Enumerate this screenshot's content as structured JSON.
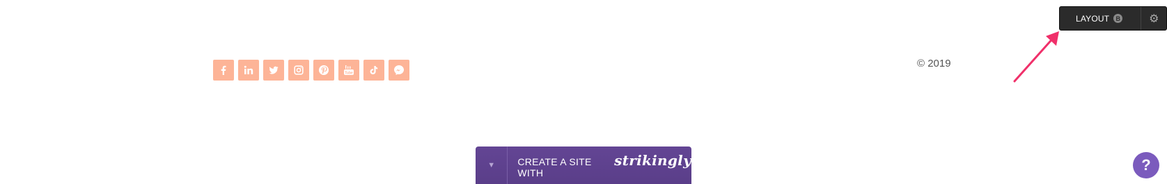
{
  "layout_control": {
    "label": "LAYOUT",
    "badge": "B",
    "settings_icon": "gear-icon"
  },
  "social": {
    "icons": [
      "facebook-icon",
      "linkedin-icon",
      "twitter-icon",
      "instagram-icon",
      "pinterest-icon",
      "youtube-icon",
      "tiktok-icon",
      "messenger-icon"
    ],
    "color": "#fdb497"
  },
  "footer": {
    "copyright": "© 2019"
  },
  "create_banner": {
    "text": "CREATE A SITE WITH",
    "brand": "strikingly",
    "toggle_icon": "caret-down-icon",
    "color": "#5f4290"
  },
  "help": {
    "label": "?",
    "color": "#7b5bbd"
  },
  "annotation": {
    "arrow_color": "#f0306a"
  }
}
